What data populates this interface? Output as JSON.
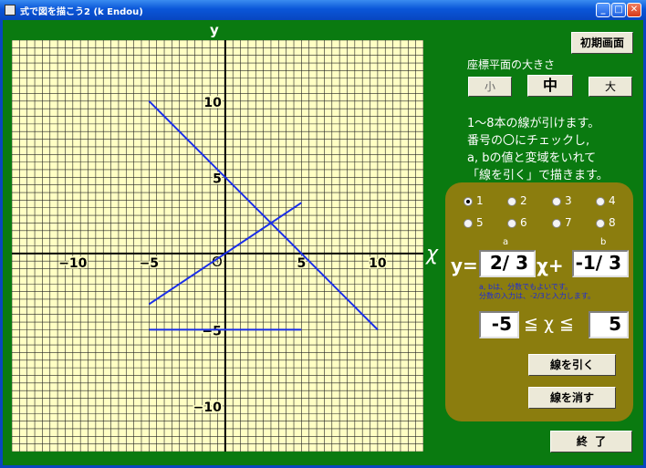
{
  "window": {
    "title": "式で図を描こう2 (k Endou)",
    "minimize": "_",
    "maximize": "□",
    "close": "✕"
  },
  "graph": {
    "y_axis_label": "y",
    "x_axis_label": "χ",
    "origin_label": "O",
    "x_tick_labels": [
      "−10",
      "−5",
      "5",
      "10"
    ],
    "y_tick_labels": [
      "10",
      "5",
      "−5",
      "−10"
    ],
    "lines": [
      {
        "x1": -5,
        "y1": 10,
        "x2": 10,
        "y2": -5
      },
      {
        "x1": -5,
        "y1": -3.33,
        "x2": 5,
        "y2": 3.33
      },
      {
        "x1": -5,
        "y1": -5,
        "x2": 5,
        "y2": -5
      }
    ],
    "xlim": [
      -14,
      13
    ],
    "ylim": [
      -13,
      14
    ],
    "line_color": "#1a2ee8"
  },
  "controls": {
    "reset_button": "初期画面",
    "size_heading": "座標平面の大きさ",
    "size_small": "小",
    "size_medium": "中",
    "size_large": "大",
    "instructions": [
      "1〜8本の線が引けます。",
      "番号の〇にチェックし,",
      "a, bの値と変域をいれて",
      "「線を引く」で描きます。"
    ],
    "radios": [
      "1",
      "2",
      "3",
      "4",
      "5",
      "6",
      "7",
      "8"
    ],
    "selected_radio": "1",
    "label_a": "a",
    "label_b": "b",
    "eq_y": "y=",
    "eq_x_plus": "χ+",
    "value_a": "2/ 3",
    "value_b": "-1/ 3",
    "note_line1": "a, bは、分数でもよいです。",
    "note_line2": "分数の入力は、-2/3と入力します。",
    "domain_from": "-5",
    "domain_mid": "≦ χ ≦",
    "domain_to": "5",
    "draw_button": "線を引く",
    "erase_button": "線を消す",
    "exit_button": "終  了"
  }
}
